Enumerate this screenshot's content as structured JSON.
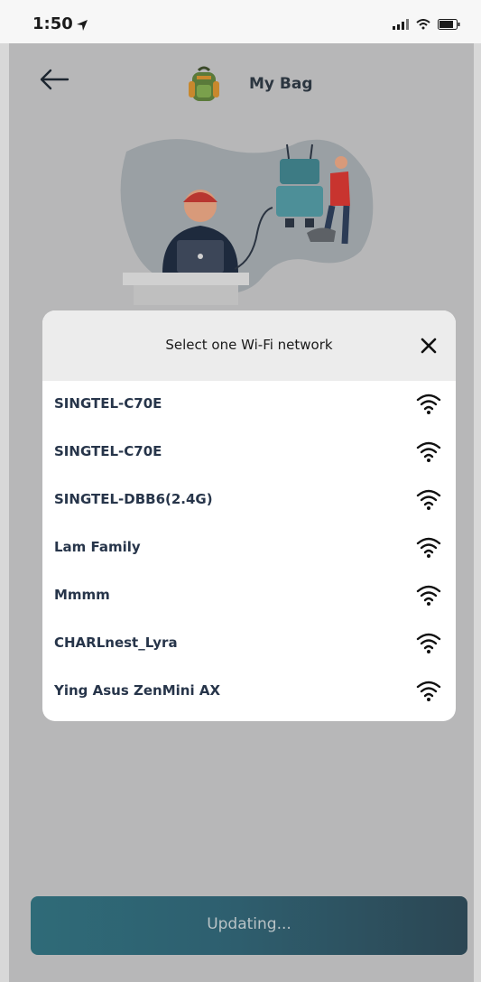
{
  "status_bar": {
    "time": "1:50"
  },
  "header": {
    "title": "My Bag"
  },
  "modal": {
    "title": "Select one Wi-Fi network",
    "networks": [
      "SINGTEL-C70E",
      "SINGTEL-C70E",
      "SINGTEL-DBB6(2.4G)",
      "Lam Family",
      "Mmmm",
      "CHARLnest_Lyra",
      "Ying Asus ZenMini AX"
    ]
  },
  "footer": {
    "button_label": "Updating..."
  },
  "colors": {
    "accent": "#2e6675",
    "background": "#b7b7b8",
    "modal_header": "#ececec",
    "text_dark": "#27354a"
  },
  "icons": {
    "back": "arrow-left-icon",
    "bag": "backpack-icon",
    "close": "close-icon",
    "wifi": "wifi-icon"
  }
}
